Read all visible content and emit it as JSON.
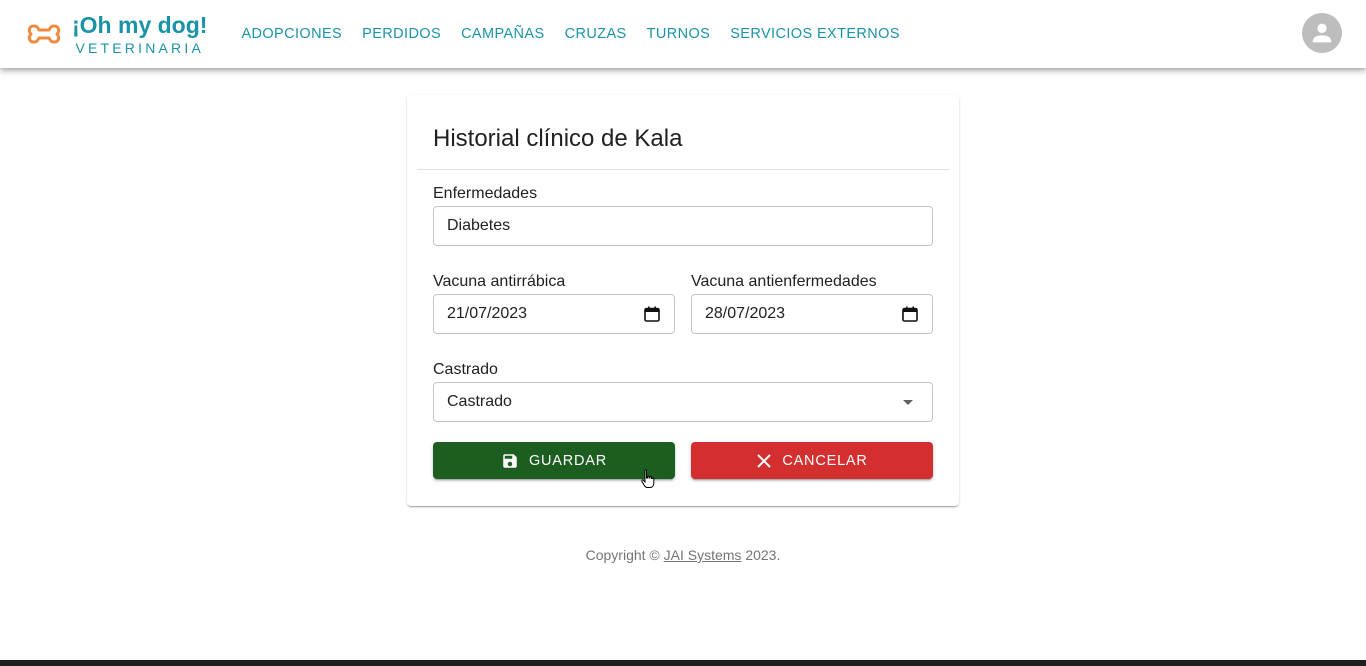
{
  "brand": {
    "title": "¡Oh my dog!",
    "subtitle": "VETERINARIA"
  },
  "nav": {
    "items": [
      "ADOPCIONES",
      "PERDIDOS",
      "CAMPAÑAS",
      "CRUZAS",
      "TURNOS",
      "SERVICIOS EXTERNOS"
    ]
  },
  "form": {
    "title": "Historial clínico de Kala",
    "enfermedades_label": "Enfermedades",
    "enfermedades_value": "Diabetes",
    "antirrabica_label": "Vacuna antirrábica",
    "antirrabica_value": "21/07/2023",
    "antienfermedades_label": "Vacuna antienfermedades",
    "antienfermedades_value": "28/07/2023",
    "castrado_label": "Castrado",
    "castrado_value": "Castrado",
    "save_label": "GUARDAR",
    "cancel_label": "CANCELAR"
  },
  "footer": {
    "prefix": "Copyright © ",
    "link": "JAI Systems",
    "suffix": " 2023."
  },
  "colors": {
    "brand": "#1b93a7",
    "logo": "#f08a3c",
    "save": "#1b5e20",
    "cancel": "#d32f2f"
  }
}
